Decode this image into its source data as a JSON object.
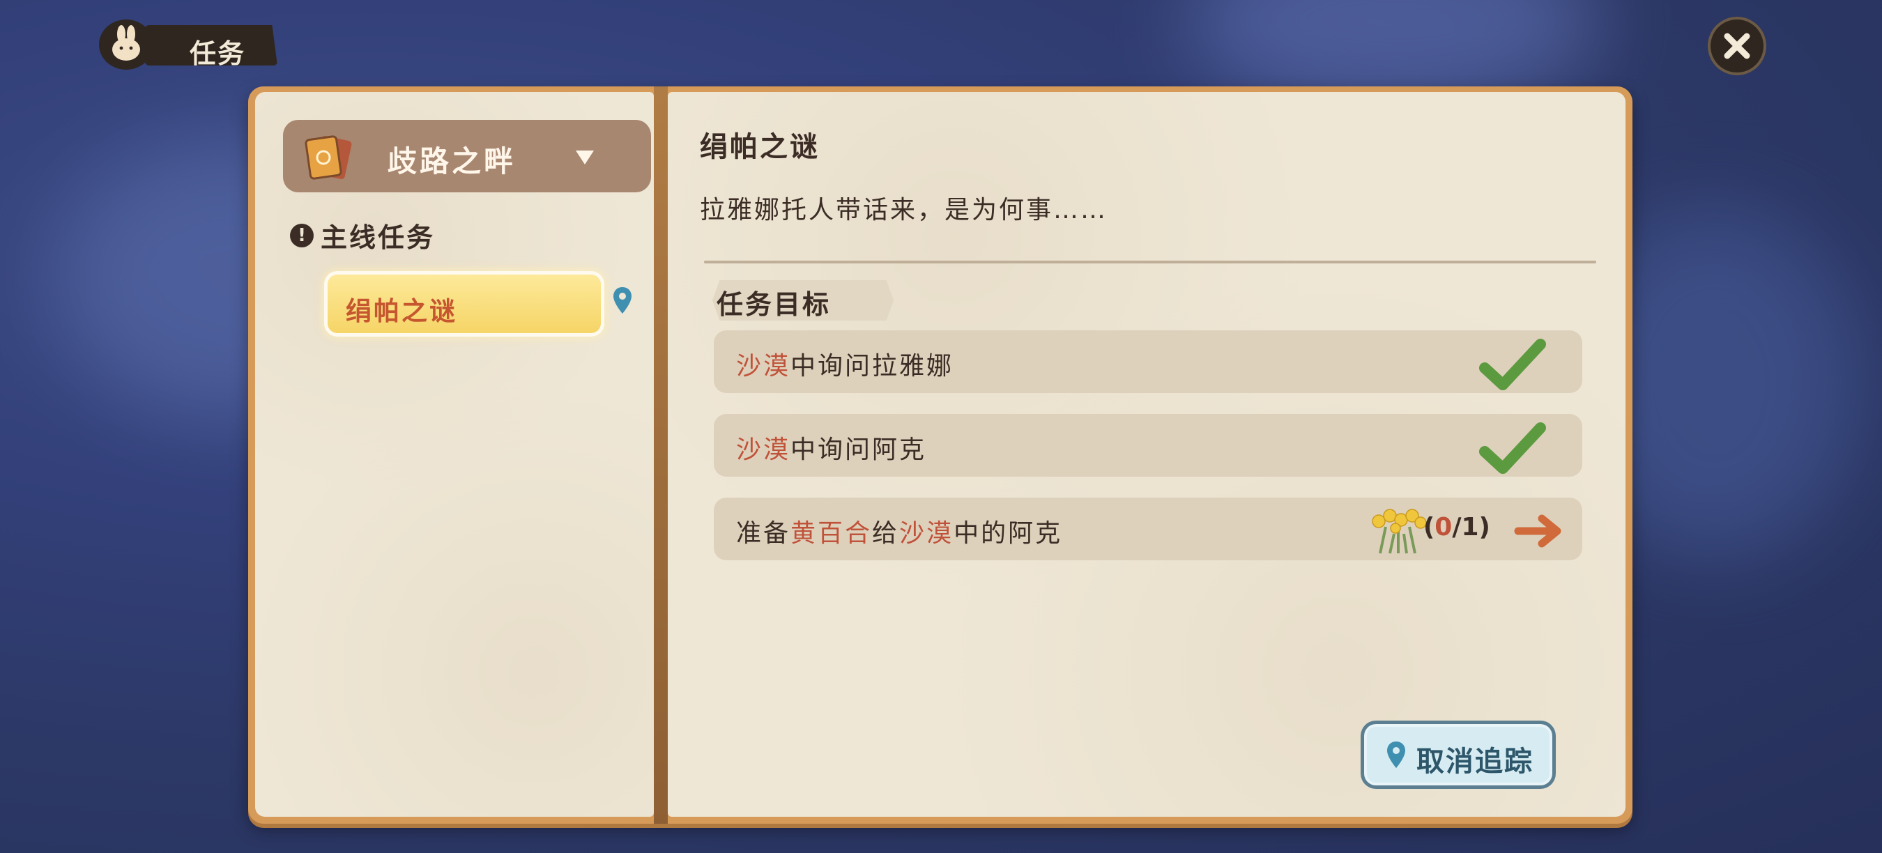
{
  "header": {
    "title": "任务"
  },
  "chapter": {
    "name": "歧路之畔"
  },
  "sections": {
    "main_label": "主线任务"
  },
  "quest_list": [
    {
      "label": "绢帕之谜",
      "selected": true
    }
  ],
  "detail": {
    "title": "绢帕之谜",
    "description": "拉雅娜托人带话来，是为何事……",
    "objectives_label": "任务目标",
    "objectives": [
      {
        "parts": [
          "沙漠",
          "中询问拉雅娜"
        ],
        "status": "done"
      },
      {
        "parts": [
          "沙漠",
          "中询问阿克"
        ],
        "status": "done"
      },
      {
        "parts": [
          "准备",
          "黄百合",
          "给",
          "沙漠",
          "中的阿克"
        ],
        "status": "in_progress",
        "count_current": "0",
        "count_sep": "/",
        "count_total": "1",
        "count_open": "(",
        "count_close": ")"
      }
    ]
  },
  "buttons": {
    "untrack": "取消追踪"
  },
  "colors": {
    "accent_red": "#c0523a",
    "check_green": "#5c9a3f",
    "arrow_orange": "#d06a3a",
    "book_border": "#d79b59"
  },
  "icons": [
    "rabbit-icon",
    "close-icon",
    "book-icon",
    "chevron-down-icon",
    "alert-icon",
    "location-pin-icon",
    "checkmark-icon",
    "lily-flower-icon",
    "arrow-right-icon"
  ]
}
